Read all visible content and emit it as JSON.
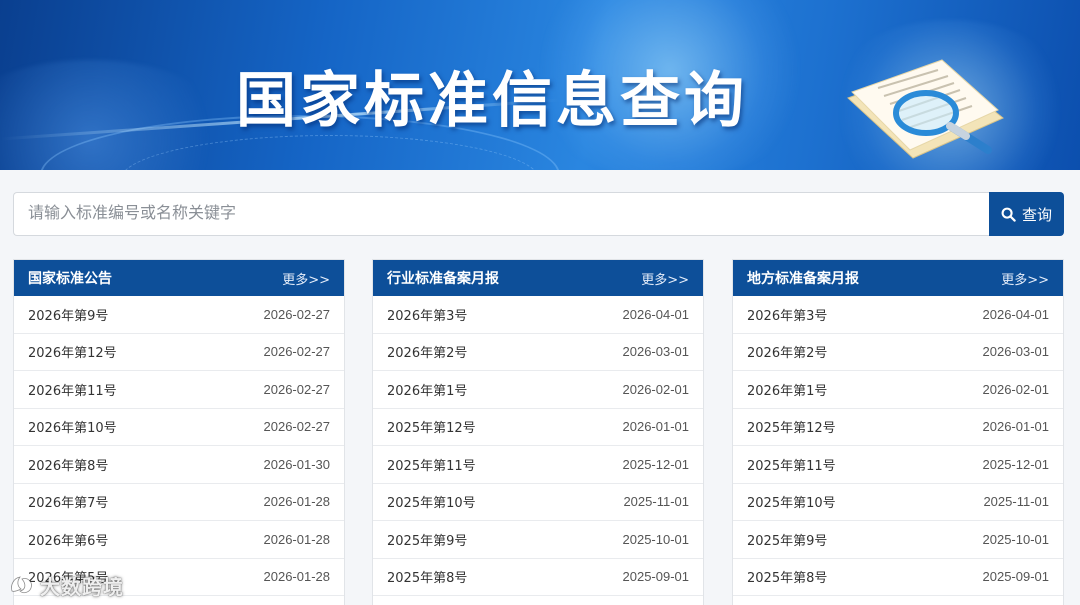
{
  "banner": {
    "title": "国家标准信息查询"
  },
  "search": {
    "placeholder": "请输入标准编号或名称关键字",
    "button_label": "查询"
  },
  "panels": [
    {
      "title": "国家标准公告",
      "more_label": "更多>>",
      "rows": [
        {
          "name": "2026年第9号",
          "date": "2026-02-27"
        },
        {
          "name": "2026年第12号",
          "date": "2026-02-27"
        },
        {
          "name": "2026年第11号",
          "date": "2026-02-27"
        },
        {
          "name": "2026年第10号",
          "date": "2026-02-27"
        },
        {
          "name": "2026年第8号",
          "date": "2026-01-30"
        },
        {
          "name": "2026年第7号",
          "date": "2026-01-28"
        },
        {
          "name": "2026年第6号",
          "date": "2026-01-28"
        },
        {
          "name": "2026年第5号",
          "date": "2026-01-28"
        }
      ]
    },
    {
      "title": "行业标准备案月报",
      "more_label": "更多>>",
      "rows": [
        {
          "name": "2026年第3号",
          "date": "2026-04-01"
        },
        {
          "name": "2026年第2号",
          "date": "2026-03-01"
        },
        {
          "name": "2026年第1号",
          "date": "2026-02-01"
        },
        {
          "name": "2025年第12号",
          "date": "2026-01-01"
        },
        {
          "name": "2025年第11号",
          "date": "2025-12-01"
        },
        {
          "name": "2025年第10号",
          "date": "2025-11-01"
        },
        {
          "name": "2025年第9号",
          "date": "2025-10-01"
        },
        {
          "name": "2025年第8号",
          "date": "2025-09-01"
        }
      ]
    },
    {
      "title": "地方标准备案月报",
      "more_label": "更多>>",
      "rows": [
        {
          "name": "2026年第3号",
          "date": "2026-04-01"
        },
        {
          "name": "2026年第2号",
          "date": "2026-03-01"
        },
        {
          "name": "2026年第1号",
          "date": "2026-02-01"
        },
        {
          "name": "2025年第12号",
          "date": "2026-01-01"
        },
        {
          "name": "2025年第11号",
          "date": "2025-12-01"
        },
        {
          "name": "2025年第10号",
          "date": "2025-11-01"
        },
        {
          "name": "2025年第9号",
          "date": "2025-10-01"
        },
        {
          "name": "2025年第8号",
          "date": "2025-09-01"
        }
      ]
    }
  ],
  "watermark": {
    "text": "大数跨境"
  },
  "colors": {
    "header_blue": "#0d4f99",
    "row_border": "#e9ebee",
    "text": "#333333"
  }
}
